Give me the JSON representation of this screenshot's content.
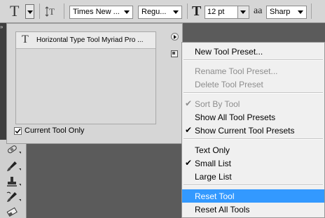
{
  "options_bar": {
    "tool_icon": "horizontal-type-tool-icon",
    "font_family": "Times New ...",
    "font_style": "Regu...",
    "font_size": "12 pt",
    "anti_alias_label": "aa",
    "anti_alias": "Sharp"
  },
  "preset_panel": {
    "items": [
      {
        "label": "Horizontal Type Tool Myriad Pro ..."
      }
    ],
    "current_tool_only_label": "Current Tool Only",
    "current_tool_only_checked": true
  },
  "menu": {
    "items": [
      {
        "label": "New Tool Preset...",
        "enabled": true,
        "checked": false
      },
      {
        "label": "Rename Tool Preset...",
        "enabled": false,
        "checked": false
      },
      {
        "label": "Delete Tool Preset",
        "enabled": false,
        "checked": false
      },
      {
        "label": "Sort By Tool",
        "enabled": false,
        "checked": true
      },
      {
        "label": "Show All Tool Presets",
        "enabled": true,
        "checked": false
      },
      {
        "label": "Show Current Tool Presets",
        "enabled": true,
        "checked": true
      },
      {
        "label": "Text Only",
        "enabled": true,
        "checked": false
      },
      {
        "label": "Small List",
        "enabled": true,
        "checked": true
      },
      {
        "label": "Large List",
        "enabled": true,
        "checked": false
      },
      {
        "label": "Reset Tool",
        "enabled": true,
        "checked": false,
        "highlighted": true
      },
      {
        "label": "Reset All Tools",
        "enabled": true,
        "checked": false
      }
    ]
  },
  "colors": {
    "highlight": "#3399ff",
    "disabled_text": "#8d8d8d",
    "canvas": "#5b5b5b"
  }
}
